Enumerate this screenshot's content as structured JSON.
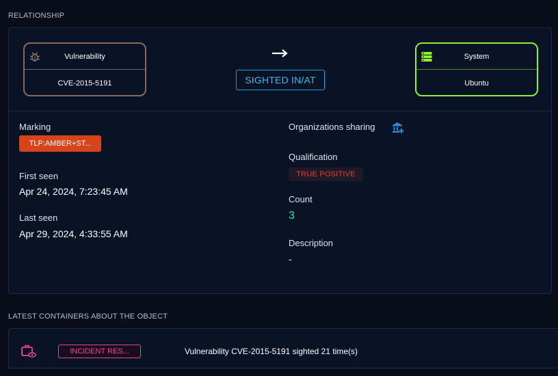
{
  "relationship": {
    "section_title": "RELATIONSHIP",
    "source": {
      "type": "Vulnerability",
      "name": "CVE-2015-5191",
      "icon": "bug-icon"
    },
    "relationship_type": "SIGHTED IN/AT",
    "target": {
      "type": "System",
      "name": "Ubuntu",
      "icon": "server-icon"
    }
  },
  "details": {
    "marking_label": "Marking",
    "marking_value": "TLP:AMBER+ST...",
    "first_seen_label": "First seen",
    "first_seen_value": "Apr 24, 2024, 7:23:45 AM",
    "last_seen_label": "Last seen",
    "last_seen_value": "Apr 29, 2024, 4:33:55 AM",
    "orgs_label": "Organizations sharing",
    "qualification_label": "Qualification",
    "qualification_value": "TRUE POSITIVE",
    "count_label": "Count",
    "count_value": "3",
    "description_label": "Description",
    "description_value": "-"
  },
  "containers": {
    "section_title": "LATEST CONTAINERS ABOUT THE OBJECT",
    "items": [
      {
        "type_label": "INCIDENT RES...",
        "name": "Vulnerability CVE-2015-5191 sighted 21 time(s)",
        "icon": "case-eye-icon"
      }
    ]
  },
  "colors": {
    "background": "#070d19",
    "panel": "#0a1326",
    "source_border": "#876a5d",
    "target_border": "#8ef22f",
    "relationship_accent": "#3fb8ea",
    "marking": "#d8441a",
    "true_positive": "#ee3b3b",
    "count": "#26e7b0",
    "incident": "#ec4690"
  }
}
